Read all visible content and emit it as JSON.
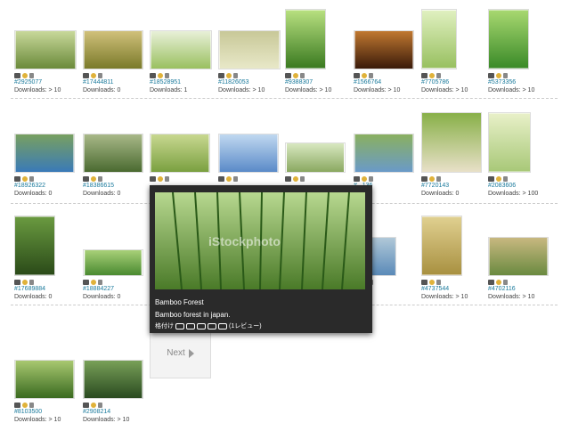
{
  "row1": [
    {
      "id": "#2925077",
      "dl": "Downloads: > 10",
      "c1": "#6a8a3a",
      "c2": "#c8d89a"
    },
    {
      "id": "#17444811",
      "dl": "Downloads: 0",
      "c1": "#7a7a2a",
      "c2": "#d0c07a"
    },
    {
      "id": "#18528951",
      "dl": "Downloads: 1",
      "c1": "#9ac060",
      "c2": "#e8f0d8"
    },
    {
      "id": "#11826053",
      "dl": "Downloads: > 10",
      "c1": "#e8e8c8",
      "c2": "#c8c898"
    },
    {
      "id": "#9388307",
      "dl": "Downloads: > 10",
      "c1": "#3a7a20",
      "c2": "#b8e080"
    },
    {
      "id": "#1566764",
      "dl": "Downloads: > 10",
      "c1": "#3a1a0a",
      "c2": "#c07830"
    },
    {
      "id": "#7705786",
      "dl": "Downloads: > 10",
      "c1": "#98c060",
      "c2": "#e0f0c0"
    },
    {
      "id": "#5373356",
      "dl": "Downloads: > 10",
      "c1": "#3a8a28",
      "c2": "#a8d870"
    }
  ],
  "row2": [
    {
      "id": "#18926322",
      "dl": "Downloads: 0",
      "c1": "#3a7ab8",
      "c2": "#78a060"
    },
    {
      "id": "#18386615",
      "dl": "Downloads: 0",
      "c1": "#4a6a30",
      "c2": "#a8b888"
    },
    {
      "id": "",
      "dl": "",
      "c1": "#7aa040",
      "c2": "#c8d890"
    },
    {
      "id": "",
      "dl": "",
      "c1": "#5a8ac8",
      "c2": "#c0d8f0"
    },
    {
      "id": "",
      "dl": "",
      "c1": "#8aa860",
      "c2": "#d8e8c0"
    },
    {
      "id": "#...136",
      "dl": "",
      "c1": "#6a9ac8",
      "c2": "#8ab060"
    },
    {
      "id": "#7720143",
      "dl": "Downloads: 0",
      "c1": "#e8e0c8",
      "c2": "#88b048"
    },
    {
      "id": "#2083606",
      "dl": "Downloads: > 100",
      "c1": "#a8c878",
      "c2": "#e8f0c8"
    }
  ],
  "row3": [
    {
      "id": "#17689884",
      "dl": "Downloads: 0",
      "c1": "#2a4a18",
      "c2": "#6a9a40"
    },
    {
      "id": "#18884227",
      "dl": "Downloads: 0",
      "c1": "#4a8a30",
      "c2": "#a8d078"
    },
    {
      "id": "...727",
      "dl": "",
      "c1": "#5a8ab8",
      "c2": "#b0c8d8"
    },
    {
      "id": "#4737544",
      "dl": "Downloads: > 10",
      "c1": "#a89040",
      "c2": "#e0d090"
    },
    {
      "id": "#4702116",
      "dl": "Downloads: > 10",
      "c1": "#6a8a40",
      "c2": "#c8b880"
    }
  ],
  "row4": [
    {
      "id": "#8103500",
      "dl": "Downloads: > 10",
      "c1": "#3a6a20",
      "c2": "#a8c870"
    },
    {
      "id": "#2908214",
      "dl": "Downloads: > 10",
      "c1": "#2a4a20",
      "c2": "#78a058"
    }
  ],
  "next_label": "Next",
  "popup": {
    "title": "Bamboo Forest",
    "desc": "Bamboo forest in japan.",
    "rating_label": "格付け",
    "review_text": "(1レビュー)",
    "watermark": "iStockphoto"
  }
}
